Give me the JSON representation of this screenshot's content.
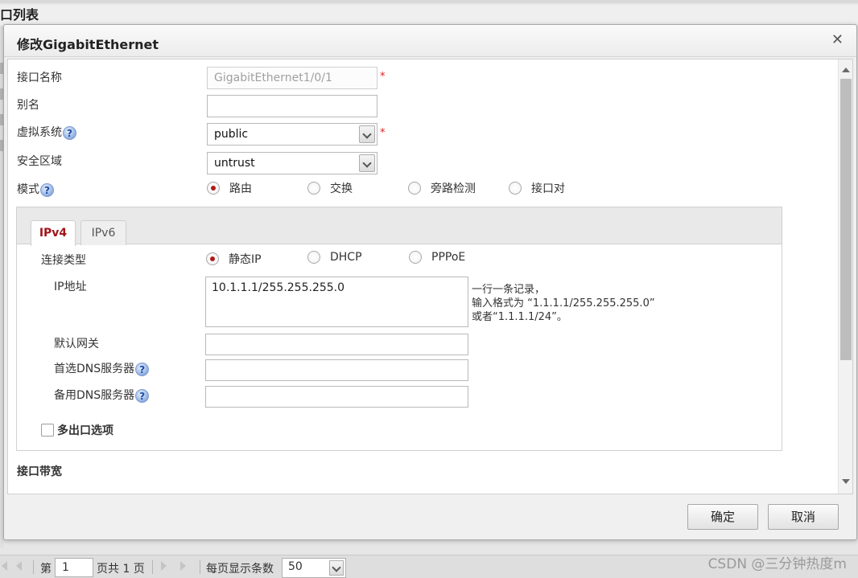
{
  "background": {
    "page_title": "口列表"
  },
  "dialog": {
    "title": "修改GigabitEthernet",
    "close_glyph": "✕",
    "fields": {
      "interface_name": {
        "label": "接口名称",
        "value": "GigabitEthernet1/0/1",
        "required": "*"
      },
      "alias": {
        "label": "别名",
        "value": ""
      },
      "virtual_system": {
        "label": "虚拟系统",
        "value": "public",
        "required": "*"
      },
      "security_zone": {
        "label": "安全区域",
        "value": "untrust"
      },
      "mode": {
        "label": "模式",
        "options": [
          "路由",
          "交换",
          "旁路检测",
          "接口对"
        ],
        "selected": "路由"
      }
    },
    "tabs": [
      "IPv4",
      "IPv6"
    ],
    "active_tab": "IPv4",
    "ipv4": {
      "connection_type": {
        "label": "连接类型",
        "options": [
          "静态IP",
          "DHCP",
          "PPPoE"
        ],
        "selected": "静态IP"
      },
      "ip_address": {
        "label": "IP地址",
        "value": "10.1.1.1/255.255.255.0",
        "hint": [
          "一行一条记录，",
          "输入格式为 “1.1.1.1/255.255.255.0”",
          "或者“1.1.1.1/24”。"
        ]
      },
      "default_gateway": {
        "label": "默认网关",
        "value": ""
      },
      "primary_dns": {
        "label": "首选DNS服务器",
        "value": ""
      },
      "secondary_dns": {
        "label": "备用DNS服务器",
        "value": ""
      },
      "multi_egress": {
        "label": "多出口选项",
        "checked": false
      }
    },
    "bandwidth_section": "接口带宽",
    "buttons": {
      "ok": "确定",
      "cancel": "取消"
    }
  },
  "pager": {
    "page_prefix": "第",
    "page_value": "1",
    "page_total": "页共 1 页",
    "page_size_label": "每页显示条数",
    "page_size_value": "50"
  },
  "watermark": "CSDN @三分钟热度m",
  "colors": {
    "accent": "#a0151b",
    "radio_on": "#b01a1a",
    "required": "#dd2222"
  }
}
